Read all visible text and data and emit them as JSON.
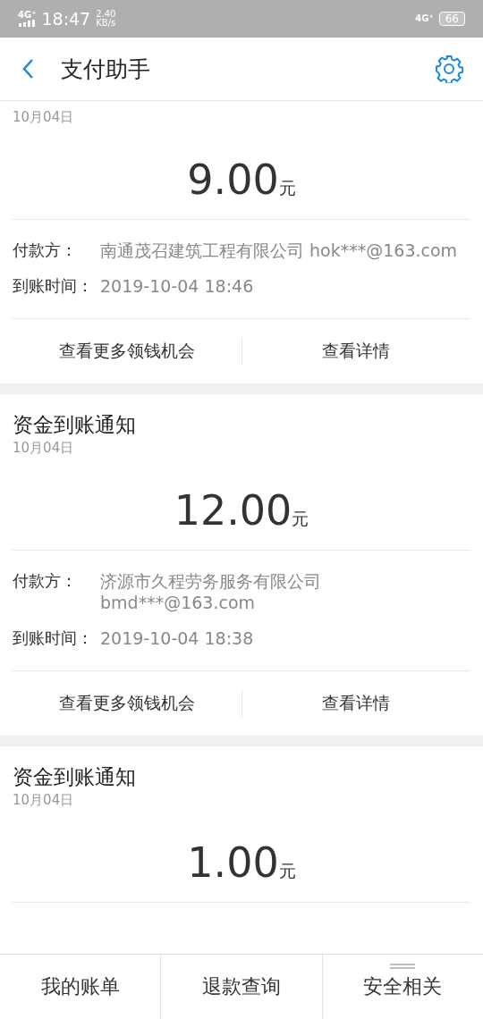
{
  "status_bar": {
    "network": "4G⁺",
    "time": "18:47",
    "speed_value": "2.40",
    "speed_unit": "KB/s",
    "network_right": "4G⁺",
    "battery": "66"
  },
  "header": {
    "title": "支付助手"
  },
  "notices": [
    {
      "date": "10月04日",
      "amount": "9.00",
      "unit": "元",
      "payer_label": "付款方：",
      "payer": "南通茂召建筑工程有限公司 hok***@163.com",
      "time_label": "到账时间：",
      "time": "2019-10-04 18:46",
      "actions": [
        "查看更多领钱机会",
        "查看详情"
      ]
    },
    {
      "title": "资金到账通知",
      "date": "10月04日",
      "amount": "12.00",
      "unit": "元",
      "payer_label": "付款方：",
      "payer": "济源市久程劳务服务有限公司 bmd***@163.com",
      "time_label": "到账时间：",
      "time": "2019-10-04 18:38",
      "actions": [
        "查看更多领钱机会",
        "查看详情"
      ]
    },
    {
      "title": "资金到账通知",
      "date": "10月04日",
      "amount": "1.00",
      "unit": "元"
    }
  ],
  "bottom_nav": [
    {
      "label": "我的账单",
      "kind": "plain"
    },
    {
      "label": "退款查询",
      "kind": "plain"
    },
    {
      "label": "安全相关",
      "kind": "menu"
    }
  ]
}
